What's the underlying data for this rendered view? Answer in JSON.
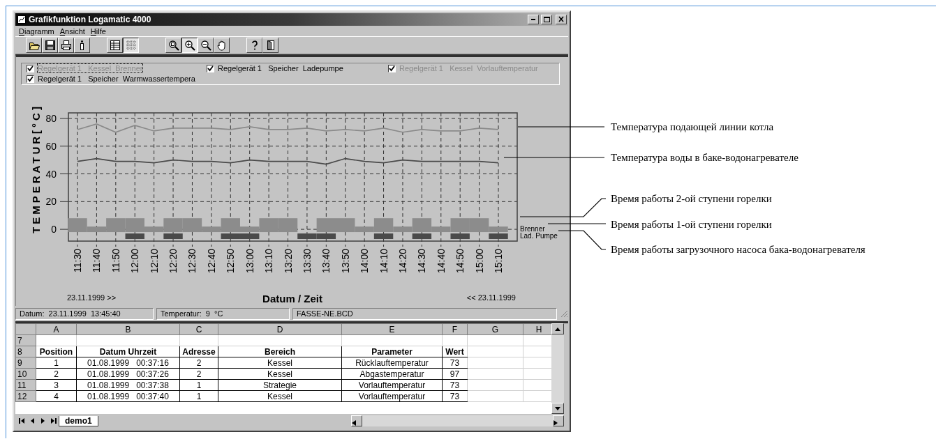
{
  "window": {
    "title": "Grafikfunktion Logamatic 4000"
  },
  "menu": [
    {
      "label": "Diagramm"
    },
    {
      "label": "Ansicht"
    },
    {
      "label": "Hilfe"
    }
  ],
  "toolbar": [
    [
      {
        "pressed": false
      },
      {
        "pressed": false
      },
      {
        "pressed": false
      },
      {
        "pressed": false
      }
    ],
    [
      {
        "pressed": false
      },
      {
        "pressed": true
      }
    ],
    [
      {
        "pressed": false
      },
      {
        "pressed": true
      },
      {
        "pressed": false
      },
      {
        "pressed": false
      }
    ],
    [
      {
        "pressed": false
      },
      {
        "pressed": false
      }
    ]
  ],
  "legend": [
    {
      "label": "Regelgerät 1   Kessel  Brenner",
      "checked": true,
      "color": "#8a8a8a",
      "focused": true
    },
    {
      "label": "Regelgerät 1   Speicher  Ladepumpe",
      "checked": true,
      "color": "#000000",
      "focused": false
    },
    {
      "label": "Regelgerät 1   Kessel  Vorlauftemperatur",
      "checked": true,
      "color": "#8a8a8a",
      "focused": false
    },
    {
      "label": "Regelgerät 1   Speicher  Warmwassertempera",
      "checked": true,
      "color": "#000000",
      "focused": false
    }
  ],
  "chart": {
    "chart_data": {
      "type": "line",
      "xlabel": "Datum / Zeit",
      "ylabel": "TEMPERATUR[°C]",
      "categories": [
        "11:30",
        "11:40",
        "11:50",
        "12:00",
        "12:10",
        "12:20",
        "12:30",
        "12:40",
        "12:50",
        "13:00",
        "13:10",
        "13:20",
        "13:30",
        "13:40",
        "13:50",
        "14:00",
        "14:10",
        "14:20",
        "14:30",
        "14:40",
        "14:50",
        "15:00",
        "15:10"
      ],
      "ylim": [
        -8.5,
        84
      ],
      "yticks": [
        0,
        20,
        40,
        60,
        80
      ],
      "grid": true,
      "series": [
        {
          "color": "#8a8a8a",
          "values": [
            72,
            76,
            70,
            75,
            71,
            73,
            73,
            73,
            72,
            74,
            72,
            72,
            73,
            71,
            72,
            71,
            73,
            70,
            72,
            71,
            71,
            73,
            72
          ]
        },
        {
          "color": "#4a4a4a",
          "values": [
            49,
            51,
            49,
            49,
            48,
            50,
            49,
            49,
            48,
            50,
            49,
            49,
            49,
            47,
            51,
            49,
            48,
            50,
            49,
            49,
            49,
            49,
            48
          ]
        }
      ]
    },
    "tracks": [
      {
        "name": "Brenner",
        "kind": "stages"
      },
      {
        "name": "Lad. Pumpe",
        "kind": "switch"
      }
    ],
    "range_start": "23.11.1999 >>",
    "range_end": "<< 23.11.1999"
  },
  "status_bar": [
    "Datum:  23.11.1999  13:45:40",
    "Temperatur:  9  °C",
    "FASSE-NE.BCD"
  ],
  "sheet": {
    "columns": [
      "A",
      "B",
      "C",
      "D",
      "E",
      "F",
      "G",
      "H"
    ],
    "rows": [
      {
        "number": "7",
        "kind": "blank"
      },
      {
        "number": "8",
        "kind": "header",
        "cells": [
          "Position",
          "Datum Uhrzeit",
          "Adresse",
          "Bereich",
          "Parameter",
          "Wert"
        ]
      },
      {
        "number": "9",
        "kind": "data",
        "cells": [
          "1",
          "01.08.1999   00:37:16",
          "2",
          "Kessel",
          "Rücklauftemperatur",
          "73"
        ]
      },
      {
        "number": "10",
        "kind": "data",
        "cells": [
          "2",
          "01.08.1999   00:37:26",
          "2",
          "Kessel",
          "Abgastemperatur",
          "97"
        ]
      },
      {
        "number": "11",
        "kind": "data",
        "cells": [
          "3",
          "01.08.1999   00:37:38",
          "1",
          "Strategie",
          "Vorlauftemperatur",
          "73"
        ]
      },
      {
        "number": "12",
        "kind": "data",
        "cells": [
          "4",
          "01.08.1999   00:37:40",
          "1",
          "Kessel",
          "Vorlauftemperatur",
          "73"
        ]
      }
    ],
    "tabs": [
      {
        "label": "demo1",
        "selected": true
      }
    ]
  },
  "callouts": [
    "Температура подающей линии котла",
    "Температура воды в баке-водонагревателе",
    "Время работы 2-ой ступени горелки",
    "Время работы 1-ой ступени горелки",
    "Время работы загрузочного насоса бака-водонагревателя"
  ]
}
